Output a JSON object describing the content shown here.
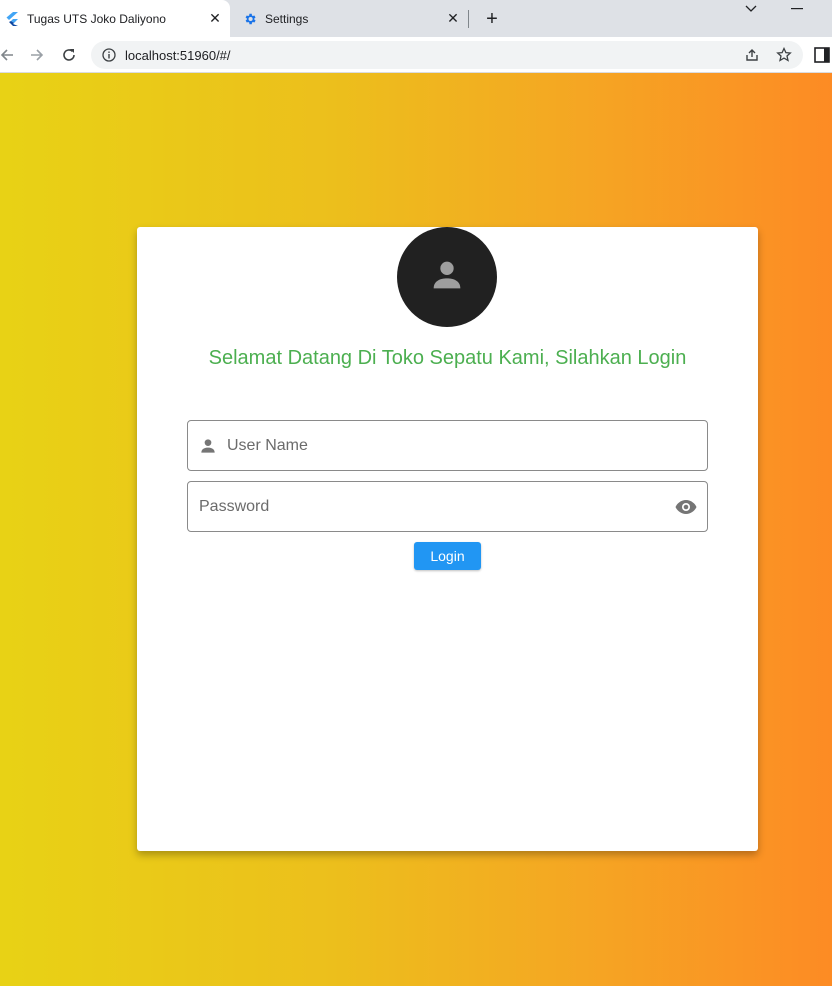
{
  "browser": {
    "tabs": [
      {
        "title": "Tugas UTS Joko Daliyono",
        "icon": "flutter-icon",
        "active": true
      },
      {
        "title": "Settings",
        "icon": "gear-icon",
        "active": false
      }
    ],
    "url": "localhost:51960/#/"
  },
  "login": {
    "welcome": "Selamat Datang Di Toko Sepatu Kami, Silahkan Login",
    "username_placeholder": "User Name",
    "password_placeholder": "Password",
    "login_label": "Login"
  },
  "colors": {
    "gradient_start": "#e8d215",
    "gradient_end": "#fd8b24",
    "welcome_text": "#4caf50",
    "login_button": "#2196f3",
    "avatar_bg": "#212121"
  }
}
